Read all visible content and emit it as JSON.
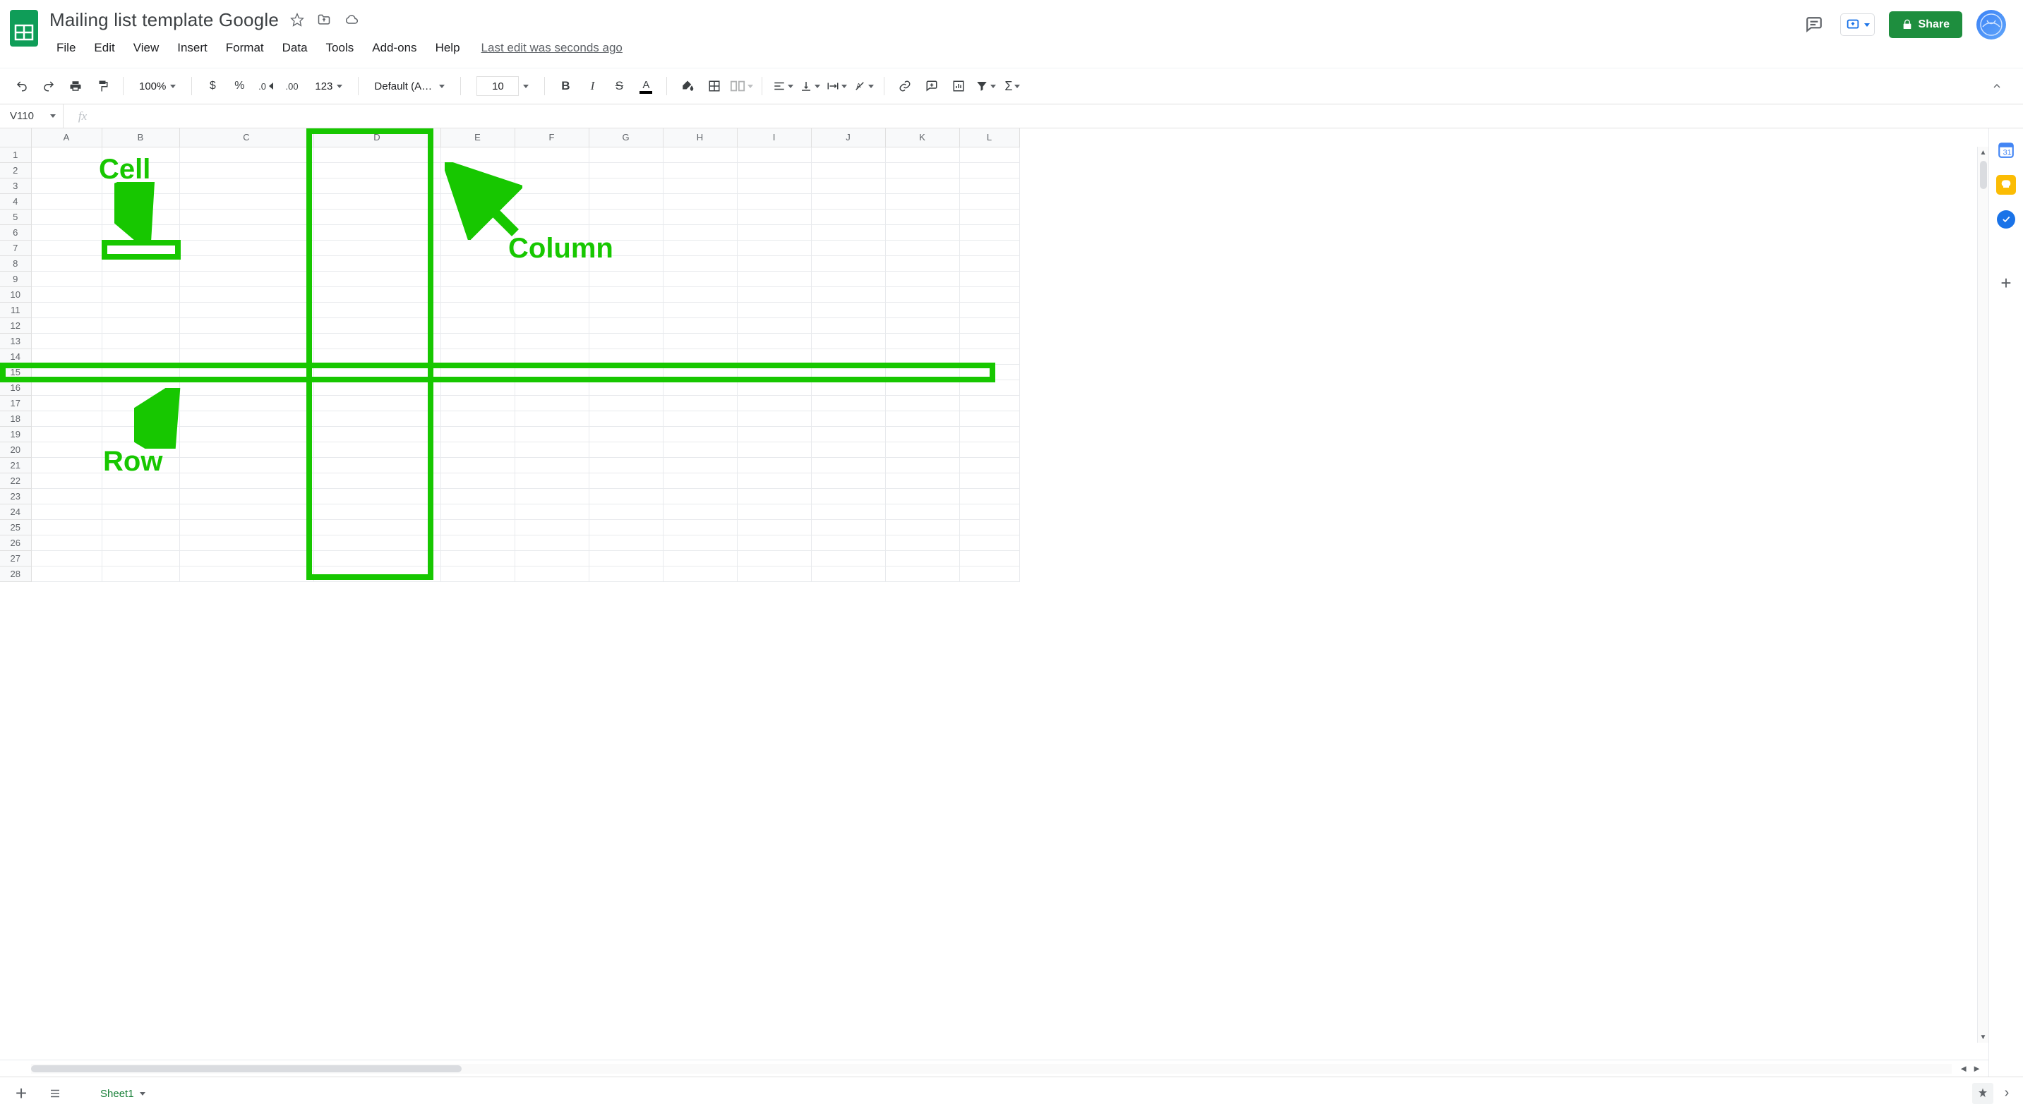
{
  "doc": {
    "title": "Mailing list template Google"
  },
  "menubar": {
    "file": "File",
    "edit": "Edit",
    "view": "View",
    "insert": "Insert",
    "format": "Format",
    "data": "Data",
    "tools": "Tools",
    "addons": "Add-ons",
    "help": "Help"
  },
  "last_edit": "Last edit was seconds ago",
  "share": {
    "label": "Share"
  },
  "toolbar": {
    "zoom": "100%",
    "currency": "$",
    "percent": "%",
    "dec_dec": ".0",
    "dec_inc": ".00",
    "num_format": "123",
    "font": "Default (Ari...",
    "font_size": "10"
  },
  "name_box": "V110",
  "fx_symbol": "fx",
  "fx_value": "",
  "columns": [
    "A",
    "B",
    "C",
    "D",
    "E",
    "F",
    "G",
    "H",
    "I",
    "J",
    "K",
    "L"
  ],
  "rows_count": 28,
  "sheet_tab": "Sheet1",
  "annotations": {
    "cell_label": "Cell",
    "column_label": "Column",
    "row_label": "Row"
  }
}
